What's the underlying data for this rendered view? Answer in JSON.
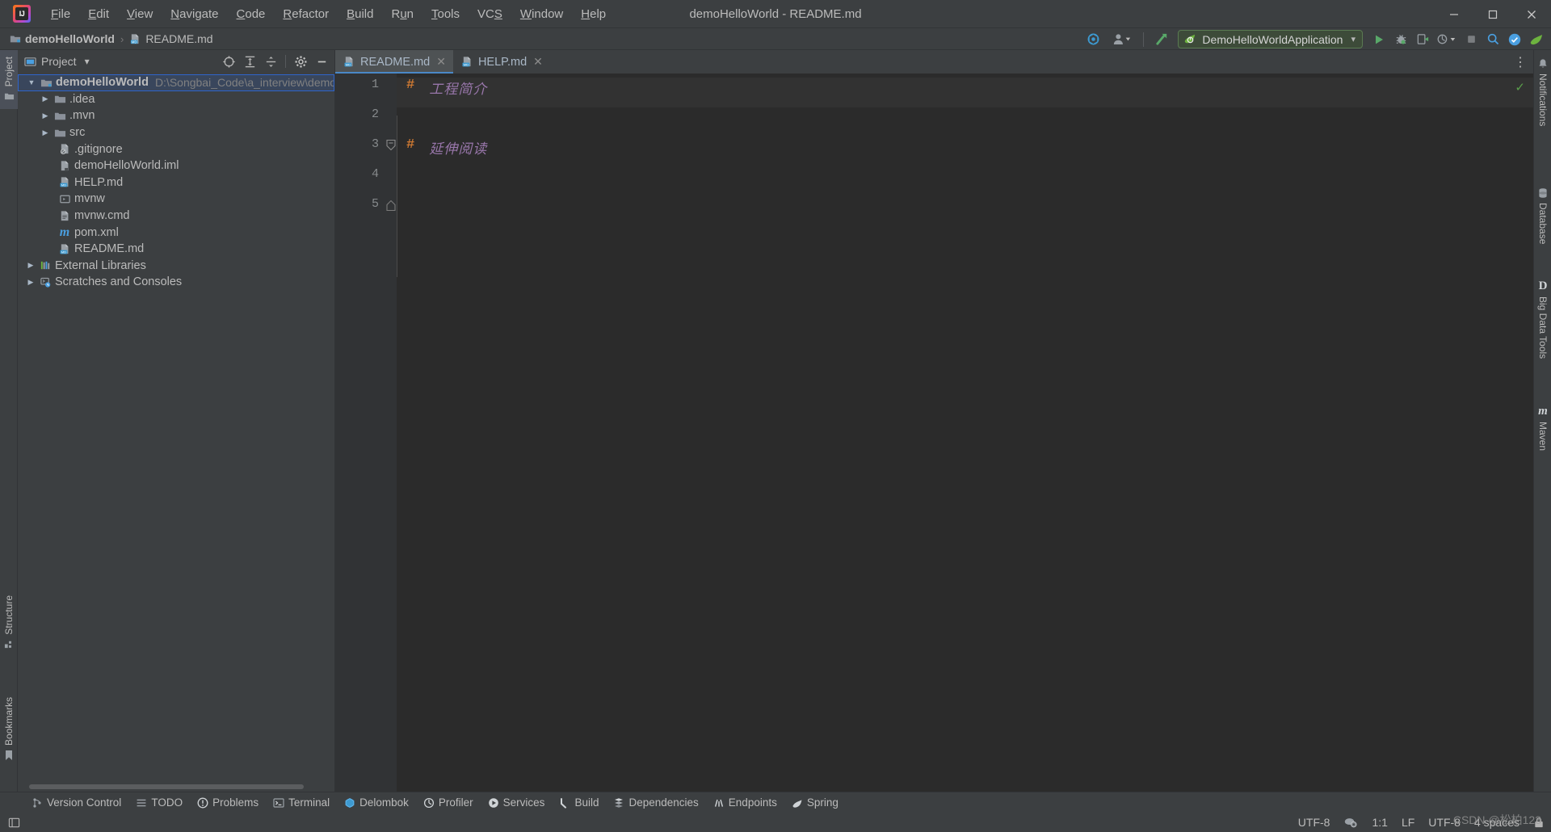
{
  "window": {
    "title": "demoHelloWorld - README.md",
    "app_icon": "intellij-idea-logo",
    "minimize_label": "—",
    "maximize_label": "❐",
    "close_label": "✕"
  },
  "menu": {
    "items": [
      {
        "label": "File",
        "mnemonic": "F"
      },
      {
        "label": "Edit",
        "mnemonic": "E"
      },
      {
        "label": "View",
        "mnemonic": "V"
      },
      {
        "label": "Navigate",
        "mnemonic": "N"
      },
      {
        "label": "Code",
        "mnemonic": "C"
      },
      {
        "label": "Refactor",
        "mnemonic": "R"
      },
      {
        "label": "Build",
        "mnemonic": "B"
      },
      {
        "label": "Run",
        "mnemonic": "u"
      },
      {
        "label": "Tools",
        "mnemonic": "T"
      },
      {
        "label": "VCS",
        "mnemonic": "S"
      },
      {
        "label": "Window",
        "mnemonic": "W"
      },
      {
        "label": "Help",
        "mnemonic": "H"
      }
    ]
  },
  "navbar": {
    "crumbs": [
      {
        "label": "demoHelloWorld",
        "icon": "project-folder-icon"
      },
      {
        "label": "README.md",
        "icon": "markdown-file-icon"
      }
    ],
    "separator": "›",
    "right_icons": [
      {
        "name": "search-everywhere-settings-icon",
        "glyph": "⚙"
      },
      {
        "name": "account-icon",
        "glyph": "👤"
      },
      {
        "name": "updates-available-icon",
        "glyph": "↗"
      }
    ],
    "run_config": {
      "name": "DemoHelloWorldApplication",
      "icon": "spring-boot-icon",
      "chevron": "▾",
      "border_color": "#5a7a52"
    },
    "run_buttons": [
      {
        "name": "run-button",
        "glyph": "▶",
        "color": "#59a869"
      },
      {
        "name": "debug-button",
        "glyph": "🐞",
        "color": "#a9b7c6"
      },
      {
        "name": "run-with-coverage-button",
        "glyph": "▷",
        "color": "#a9b7c6"
      },
      {
        "name": "more-run-options-button",
        "glyph": "▾",
        "color": "#a9b7c6"
      },
      {
        "name": "stop-button",
        "glyph": "■",
        "color": "#8b8b8b"
      },
      {
        "name": "search-icon",
        "glyph": "🔍",
        "color": "#a9b7c6"
      }
    ]
  },
  "left_strip": {
    "top": [
      {
        "label": "Project",
        "icon": "project-panel-icon",
        "selected": true
      }
    ],
    "bottom": [
      {
        "label": "Structure",
        "icon": "structure-icon",
        "selected": false
      },
      {
        "label": "Bookmarks",
        "icon": "bookmark-icon",
        "selected": false
      }
    ]
  },
  "right_strip": {
    "items": [
      {
        "label": "Notifications",
        "icon": "bell-icon"
      },
      {
        "label": "Database",
        "icon": "database-icon"
      },
      {
        "label": "Big Data Tools",
        "icon": "big-data-tools-icon"
      },
      {
        "label": "Maven",
        "icon": "maven-icon"
      }
    ]
  },
  "project_panel": {
    "title": "Project",
    "title_chevron": "▾",
    "icon": "project-panel-icon",
    "tools": [
      {
        "name": "select-opened-file-icon",
        "glyph": "⊕"
      },
      {
        "name": "expand-all-icon",
        "glyph": "⤓"
      },
      {
        "name": "collapse-all-icon",
        "glyph": "⤒"
      },
      {
        "name": "settings-gear-icon",
        "glyph": "⚙"
      },
      {
        "name": "hide-panel-icon",
        "glyph": "—"
      }
    ],
    "tree": [
      {
        "label": "demoHelloWorld",
        "path": "D:\\Songbai_Code\\a_interview\\demoHell",
        "icon": "project-root-icon",
        "arrow": "expanded",
        "indent": 0,
        "bold": true,
        "selected": true
      },
      {
        "label": ".idea",
        "icon": "folder-icon",
        "arrow": "collapsed",
        "indent": 1
      },
      {
        "label": ".mvn",
        "icon": "folder-icon",
        "arrow": "collapsed",
        "indent": 1
      },
      {
        "label": "src",
        "icon": "folder-icon",
        "arrow": "collapsed",
        "indent": 1
      },
      {
        "label": ".gitignore",
        "icon": "gitignore-file-icon",
        "arrow": "none",
        "indent": 2
      },
      {
        "label": "demoHelloWorld.iml",
        "icon": "iml-file-icon",
        "arrow": "none",
        "indent": 2
      },
      {
        "label": "HELP.md",
        "icon": "markdown-file-icon",
        "arrow": "none",
        "indent": 2
      },
      {
        "label": "mvnw",
        "icon": "shell-script-icon",
        "arrow": "none",
        "indent": 2
      },
      {
        "label": "mvnw.cmd",
        "icon": "cmd-file-icon",
        "arrow": "none",
        "indent": 2
      },
      {
        "label": "pom.xml",
        "icon": "maven-pom-icon",
        "arrow": "none",
        "indent": 2
      },
      {
        "label": "README.md",
        "icon": "markdown-file-icon",
        "arrow": "none",
        "indent": 2
      },
      {
        "label": "External Libraries",
        "icon": "external-libraries-icon",
        "arrow": "collapsed",
        "indent": 0
      },
      {
        "label": "Scratches and Consoles",
        "icon": "scratches-icon",
        "arrow": "collapsed",
        "indent": 0
      }
    ]
  },
  "editor": {
    "tabs": [
      {
        "label": "README.md",
        "icon": "markdown-file-icon",
        "active": true,
        "close": "✕"
      },
      {
        "label": "HELP.md",
        "icon": "markdown-file-icon",
        "active": false,
        "close": "✕"
      }
    ],
    "tabbar_more": "⋮",
    "inspection_status": "✓",
    "inspection_color": "#5a9e4b",
    "lines": [
      {
        "number": "1",
        "hash": "#",
        "text": "工程简介",
        "fold": false,
        "current": true
      },
      {
        "number": "2",
        "hash": "",
        "text": "",
        "fold": false,
        "current": false
      },
      {
        "number": "3",
        "hash": "#",
        "text": "延伸阅读",
        "fold": true,
        "current": false
      },
      {
        "number": "4",
        "hash": "",
        "text": "",
        "fold": false,
        "current": false
      },
      {
        "number": "5",
        "hash": "",
        "text": "",
        "fold": false,
        "current": false
      }
    ],
    "syntax_colors": {
      "heading_marker": "#cc7832",
      "heading_text": "#9876aa"
    }
  },
  "bottom_bar": {
    "items": [
      {
        "label": "Version Control",
        "icon": "version-control-icon"
      },
      {
        "label": "TODO",
        "icon": "todo-icon"
      },
      {
        "label": "Problems",
        "icon": "problems-icon"
      },
      {
        "label": "Terminal",
        "icon": "terminal-icon"
      },
      {
        "label": "Delombok",
        "icon": "delombok-icon"
      },
      {
        "label": "Profiler",
        "icon": "profiler-icon"
      },
      {
        "label": "Services",
        "icon": "services-icon"
      },
      {
        "label": "Build",
        "icon": "build-icon"
      },
      {
        "label": "Dependencies",
        "icon": "dependencies-icon"
      },
      {
        "label": "Endpoints",
        "icon": "endpoints-icon"
      },
      {
        "label": "Spring",
        "icon": "spring-icon"
      }
    ]
  },
  "status_bar": {
    "left_icon": "show-hide-toolwindows-icon",
    "encoding_label": "UTF-8",
    "inspections_icon": "inspections-widget-icon",
    "caret_position": "1:1",
    "line_separator": "LF",
    "file_encoding": "UTF-8",
    "indent": "4 spaces",
    "lock_icon": "readonly-toggle-icon",
    "watermark": "CSDN @松柏123"
  }
}
